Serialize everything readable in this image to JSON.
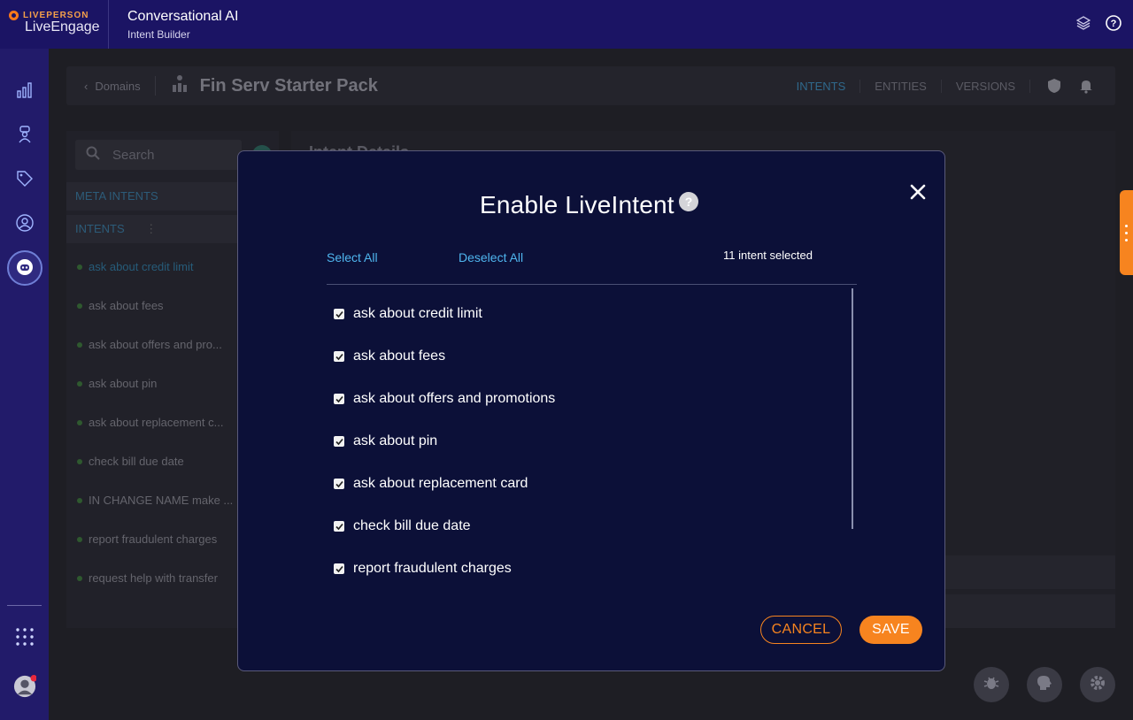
{
  "brand": {
    "company": "LIVEPERSON",
    "product": "LiveEngage"
  },
  "app": {
    "title": "Conversational AI",
    "subtitle": "Intent Builder"
  },
  "breadcrumb": {
    "back_label": "Domains",
    "domain_title": "Fin Serv Starter Pack"
  },
  "tabs": [
    {
      "label": "INTENTS",
      "active": true
    },
    {
      "label": "ENTITIES",
      "active": false
    },
    {
      "label": "VERSIONS",
      "active": false
    }
  ],
  "left_panel": {
    "search_placeholder": "Search",
    "meta_intents_label": "META INTENTS",
    "intents_label": "INTENTS",
    "intents": [
      "ask about credit limit",
      "ask about fees",
      "ask about offers and pro...",
      "ask about pin",
      "ask about replacement c...",
      "check bill due date",
      "IN CHANGE NAME make ...",
      "report fraudulent charges",
      "request help with transfer"
    ]
  },
  "right_panel": {
    "title": "Intent Details"
  },
  "modal": {
    "title": "Enable LiveIntent",
    "help_symbol": "?",
    "select_all": "Select All",
    "deselect_all": "Deselect All",
    "selected_count": "11 intent selected",
    "items": [
      {
        "label": "ask about credit limit",
        "checked": true
      },
      {
        "label": "ask about fees",
        "checked": true
      },
      {
        "label": "ask about offers and promotions",
        "checked": true
      },
      {
        "label": "ask about pin",
        "checked": true
      },
      {
        "label": "ask about replacement card",
        "checked": true
      },
      {
        "label": "check bill due date",
        "checked": true
      },
      {
        "label": "report fraudulent charges",
        "checked": true
      }
    ],
    "cancel_label": "CANCEL",
    "save_label": "SAVE"
  },
  "colors": {
    "accent": "#f7841f",
    "link": "#4fb6ef",
    "modal_bg": "#0c1038",
    "topbar": "#1b1464"
  }
}
